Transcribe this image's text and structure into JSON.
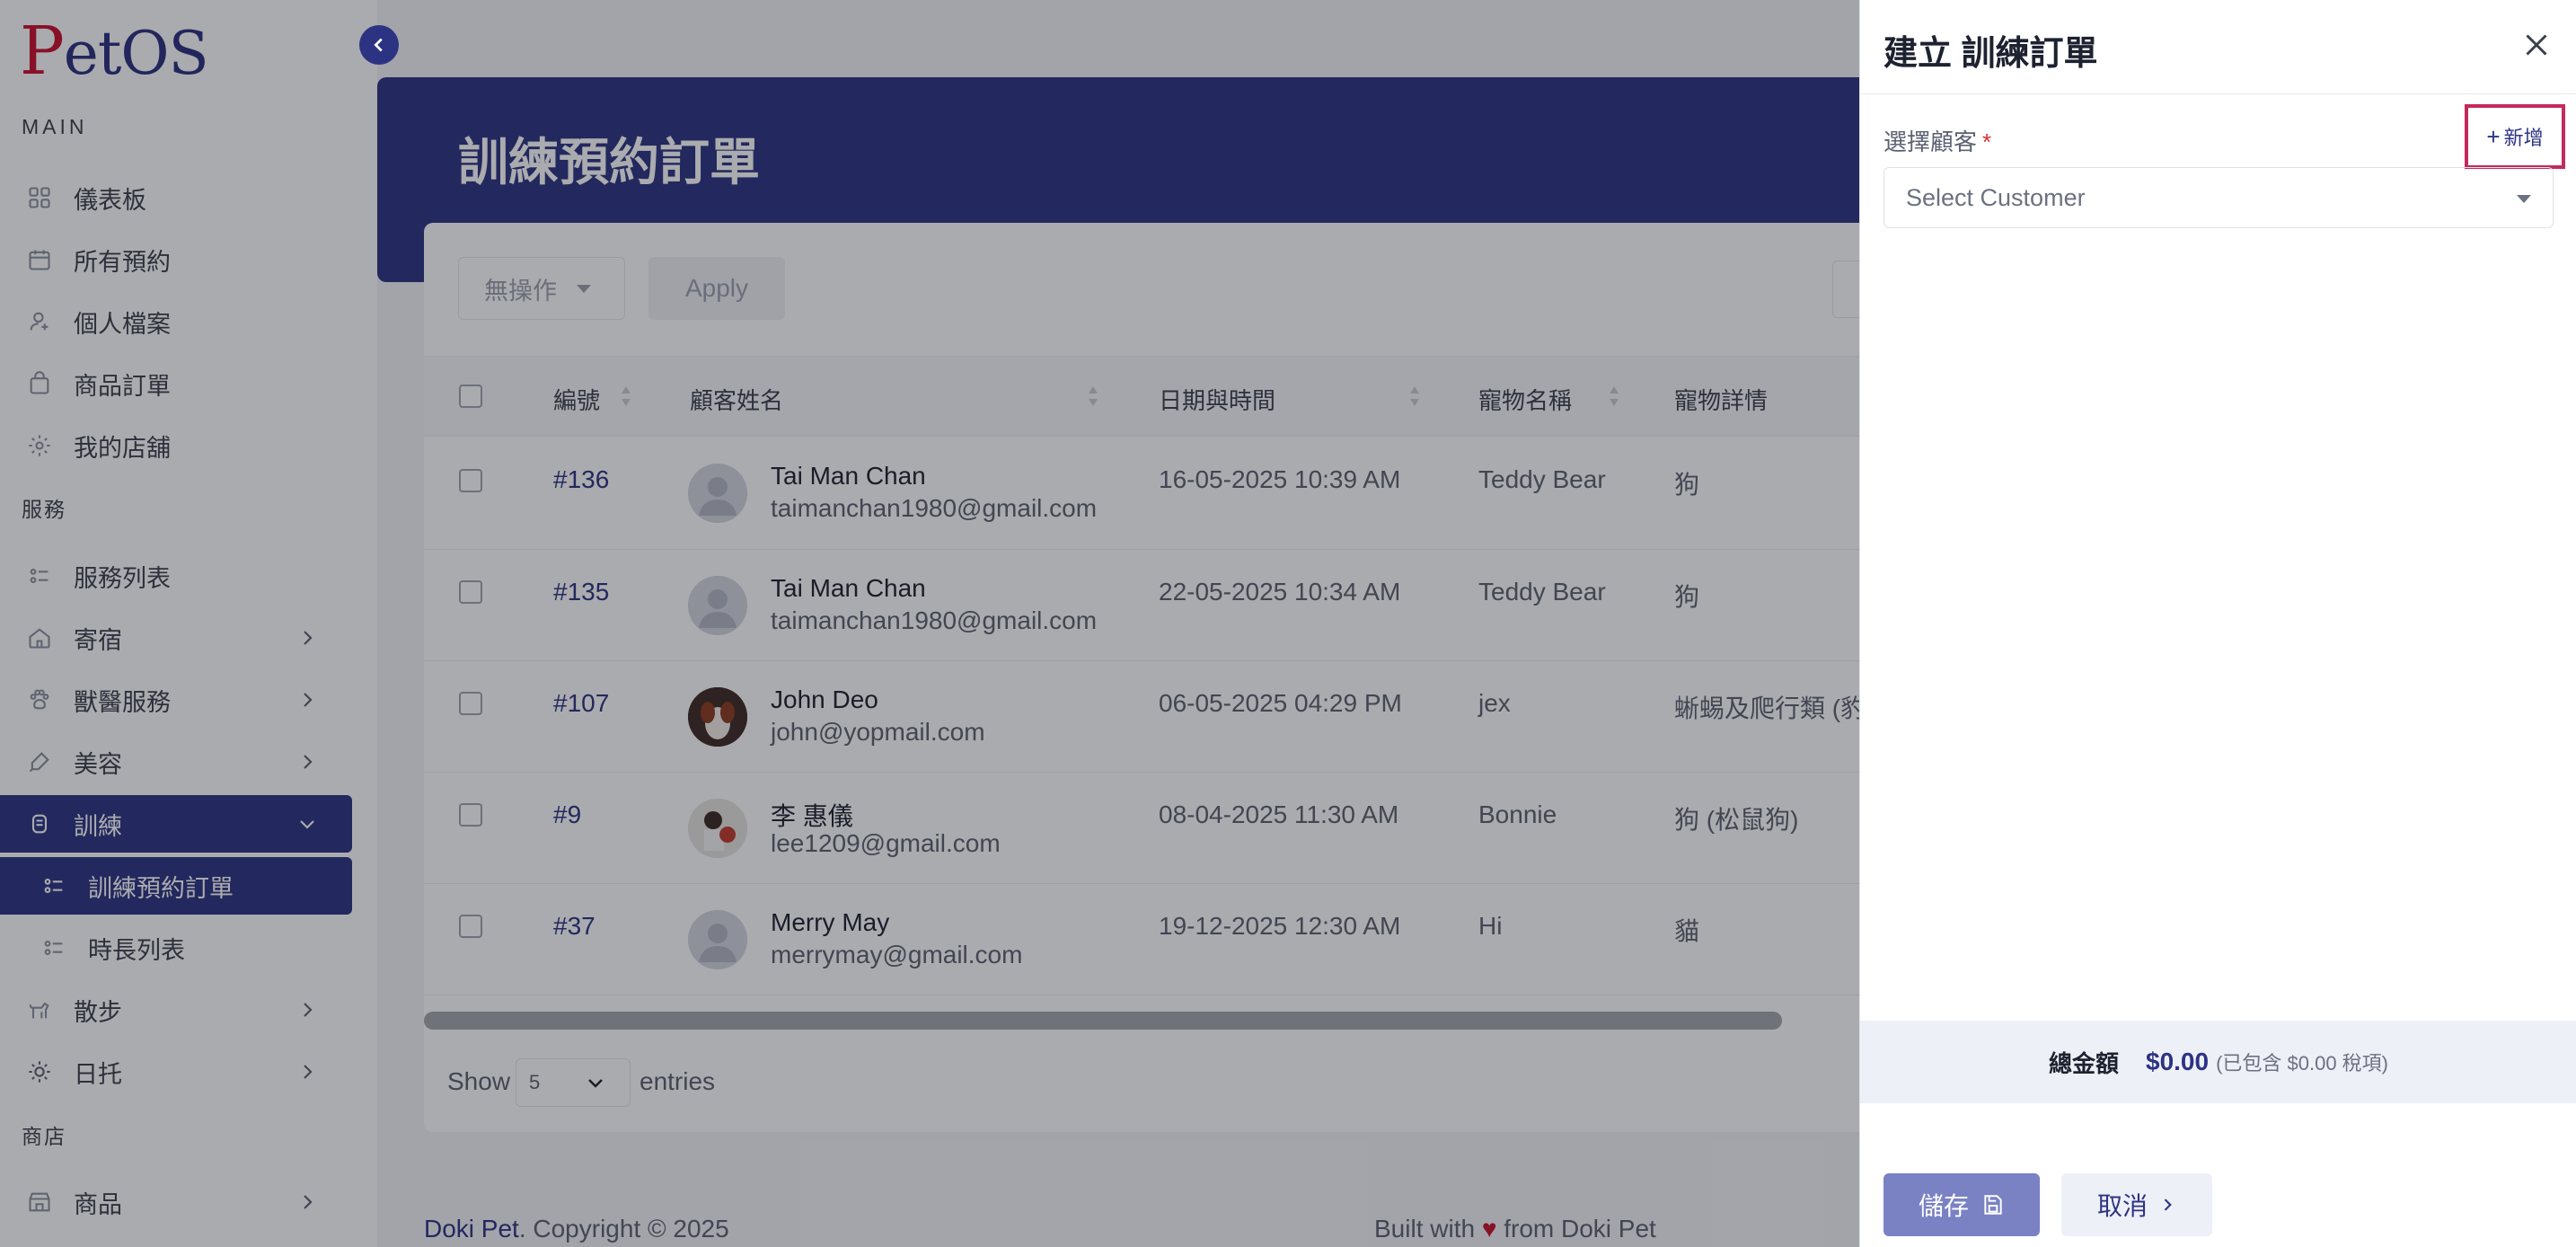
{
  "app": {
    "logo": "PetOS"
  },
  "sidebar": {
    "section_main": "MAIN",
    "section_services": "服務",
    "section_shop": "商店",
    "items": [
      {
        "label": "儀表板",
        "icon": "grid-icon"
      },
      {
        "label": "所有預約",
        "icon": "calendar-icon"
      },
      {
        "label": "個人檔案",
        "icon": "user-icon"
      },
      {
        "label": "商品訂單",
        "icon": "bag-icon"
      },
      {
        "label": "我的店舖",
        "icon": "store-icon"
      },
      {
        "label": "服務列表",
        "icon": "list-icon"
      },
      {
        "label": "寄宿",
        "icon": "home-icon"
      },
      {
        "label": "獸醫服務",
        "icon": "paw-icon"
      },
      {
        "label": "美容",
        "icon": "brush-icon"
      },
      {
        "label": "訓練",
        "icon": "training-icon"
      },
      {
        "label": "訓練預約訂單",
        "icon": "list-icon"
      },
      {
        "label": "時長列表",
        "icon": "list-icon"
      },
      {
        "label": "散步",
        "icon": "dog-icon"
      },
      {
        "label": "日托",
        "icon": "sun-icon"
      },
      {
        "label": "商品",
        "icon": "shop-icon"
      }
    ]
  },
  "page": {
    "title": "訓練預約訂單",
    "bulk_action": "無操作",
    "apply": "Apply",
    "columns": [
      "編號",
      "顧客姓名",
      "日期與時間",
      "寵物名稱",
      "寵物詳情"
    ],
    "rows": [
      {
        "id": "#136",
        "name": "Tai Man Chan",
        "email": "taimanchan1980@gmail.com",
        "datetime": "16-05-2025 10:39 AM",
        "pet": "Teddy Bear",
        "detail": "狗"
      },
      {
        "id": "#135",
        "name": "Tai Man Chan",
        "email": "taimanchan1980@gmail.com",
        "datetime": "22-05-2025 10:34 AM",
        "pet": "Teddy Bear",
        "detail": "狗"
      },
      {
        "id": "#107",
        "name": "John Deo",
        "email": "john@yopmail.com",
        "datetime": "06-05-2025 04:29 PM",
        "pet": "jex",
        "detail": "蜥蜴及爬行類 (豹紋"
      },
      {
        "id": "#9",
        "name": "李 惠儀",
        "email": "lee1209@gmail.com",
        "datetime": "08-04-2025 11:30 AM",
        "pet": "Bonnie",
        "detail": "狗 (松鼠狗)"
      },
      {
        "id": "#37",
        "name": "Merry May",
        "email": "merrymay@gmail.com",
        "datetime": "19-12-2025 12:30 AM",
        "pet": "Hi",
        "detail": "貓"
      }
    ],
    "show": "Show",
    "entries_value": "5",
    "entries": "entries"
  },
  "footer": {
    "brand": "Doki Pet",
    "copyright": ". Copyright © 2025",
    "built_prefix": "Built with",
    "heart": "♥",
    "built_suffix": "from Doki Pet"
  },
  "drawer": {
    "title": "建立 訓練訂單",
    "customer_label": "選擇顧客",
    "required_mark": "*",
    "add_label": "新增",
    "add_plus": "+",
    "customer_placeholder": "Select Customer",
    "total_label": "總金額",
    "total_value": "$0.00",
    "total_note": "(已包含 $0.00 稅項)",
    "save_label": "儲存",
    "cancel_label": "取消"
  },
  "colors": {
    "primary": "#2d3383",
    "accent": "#c8102e",
    "highlight": "#c42a5c"
  }
}
